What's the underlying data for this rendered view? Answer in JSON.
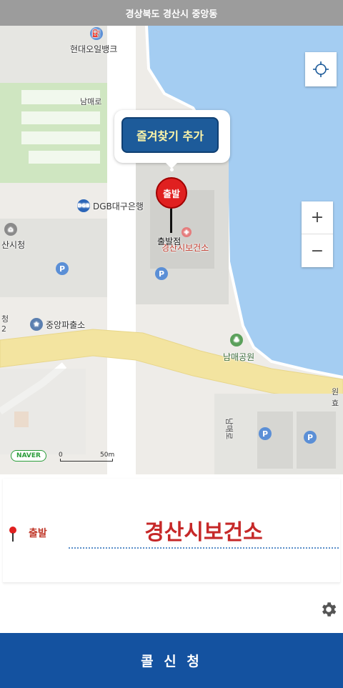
{
  "header": {
    "location": "경상북도 경산시 중앙동"
  },
  "map": {
    "pois": {
      "gas_station": "현대오일뱅크",
      "bank": "DGB대구은행",
      "bank_logo": "DGB",
      "city_hall": "산시청",
      "police": "중앙파출소",
      "health_center": "경산시보건소",
      "park": "남매공원",
      "edge_label_a": "청",
      "edge_label_b": "2"
    },
    "roads": {
      "nammae_ro": "남매로",
      "nammae_ro_vertical": "남매로",
      "edge_road": "원효"
    },
    "parking_symbol": "P",
    "favorite_button": "즐겨찾기 추가",
    "pin": {
      "label": "출발",
      "text": "출발점"
    },
    "zoom": {
      "in": "+",
      "out": "−"
    },
    "naver_logo": "NAVER",
    "scale": {
      "zero": "0",
      "max": "50m"
    }
  },
  "origin": {
    "tag": "출발",
    "name": "경산시보건소"
  },
  "call_button": "콜 신 청",
  "colors": {
    "header_bg": "#9c9c9c",
    "water": "#a4cdf2",
    "road": "#f3e4a0",
    "green": "#cfe6c1",
    "call_bg": "#1452a0",
    "pin": "#e02020"
  },
  "icons": [
    "gas-icon",
    "bank-icon",
    "city-hall-icon",
    "police-icon",
    "hospital-icon",
    "park-icon",
    "parking-icon",
    "locate-icon",
    "gear-icon",
    "pin-icon"
  ]
}
